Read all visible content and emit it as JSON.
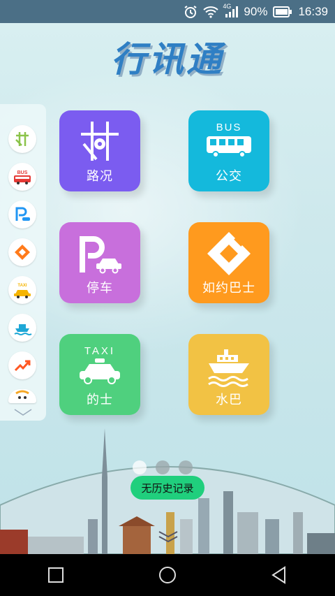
{
  "status_bar": {
    "network": "4G",
    "battery": "90%",
    "time": "16:39",
    "icons": [
      "alarm-icon",
      "wifi-icon",
      "signal-icon",
      "battery-icon"
    ]
  },
  "app": {
    "title": "行讯通"
  },
  "sidebar": {
    "items": [
      {
        "name": "road-condition",
        "icon": "road-icon",
        "color": "#8bc34a"
      },
      {
        "name": "bus",
        "icon": "bus-icon",
        "text": "BUS",
        "color": "#e53935"
      },
      {
        "name": "parking",
        "icon": "parking-icon",
        "color": "#2196f3"
      },
      {
        "name": "ruyue-bus",
        "icon": "diamond-icon",
        "color": "#ff7a1a"
      },
      {
        "name": "taxi",
        "icon": "taxi-icon",
        "text": "TAXI",
        "color": "#f5b400"
      },
      {
        "name": "water-bus",
        "icon": "ship-icon",
        "color": "#1ea7d6"
      },
      {
        "name": "trend",
        "icon": "trend-icon",
        "color": "#ff5722"
      },
      {
        "name": "more",
        "icon": "face-icon",
        "color": "#f5a623"
      }
    ]
  },
  "tiles": [
    {
      "key": "road",
      "label": "路况",
      "color": "#7b5cf0"
    },
    {
      "key": "bus",
      "label": "公交",
      "badge": "BUS",
      "color": "#14b9dc"
    },
    {
      "key": "parking",
      "label": "停车",
      "color": "#c86fdc"
    },
    {
      "key": "ruyue",
      "label": "如约巴士",
      "color": "#ff9a1e"
    },
    {
      "key": "taxi",
      "label": "的士",
      "badge": "TAXI",
      "color": "#4fd07e"
    },
    {
      "key": "water",
      "label": "水巴",
      "color": "#f2c244"
    }
  ],
  "pager": {
    "count": 3,
    "active": 0
  },
  "history": {
    "label": "无历史记录"
  },
  "nav_bar": {
    "icons": [
      "recent-apps-icon",
      "home-icon",
      "back-icon"
    ]
  }
}
